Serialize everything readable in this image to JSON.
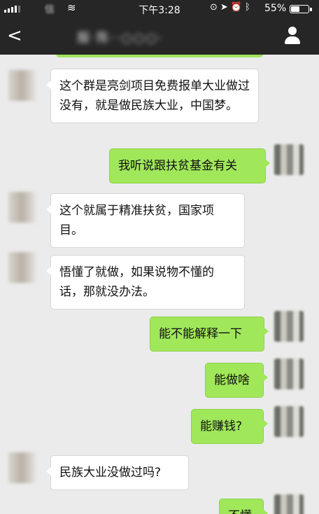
{
  "status_bar": {
    "carrier": "信",
    "time": "下午3:28",
    "battery_text": "55%",
    "battery_level": 0.55,
    "icons": [
      "screen-lock-icon",
      "location-arrow-icon",
      "alarm-icon",
      "bluetooth-icon"
    ]
  },
  "nav": {
    "back_glyph": "<",
    "title": "服·陈··○○○·"
  },
  "messages": [
    {
      "side": "in",
      "text": "这个群是亮剑项目免费报单大业做过没有，就是做民族大业，中国梦。"
    },
    {
      "side": "out",
      "text": "我听说跟扶贫基金有关"
    },
    {
      "side": "in",
      "text": "这个就属于精准扶贫，国家项目。"
    },
    {
      "side": "in",
      "text": "悟懂了就做，如果说物不懂的话，那就没办法。"
    },
    {
      "side": "out",
      "text": "能不能解释一下"
    },
    {
      "side": "out",
      "text": "能做啥"
    },
    {
      "side": "out",
      "text": "能赚钱?"
    },
    {
      "side": "in",
      "text": "民族大业没做过吗?"
    },
    {
      "side": "out",
      "text": "不懂"
    }
  ],
  "colors": {
    "bar": "#262626",
    "chat_bg": "#ebebeb",
    "out_bubble": "#a0e75a",
    "in_bubble": "#ffffff"
  }
}
